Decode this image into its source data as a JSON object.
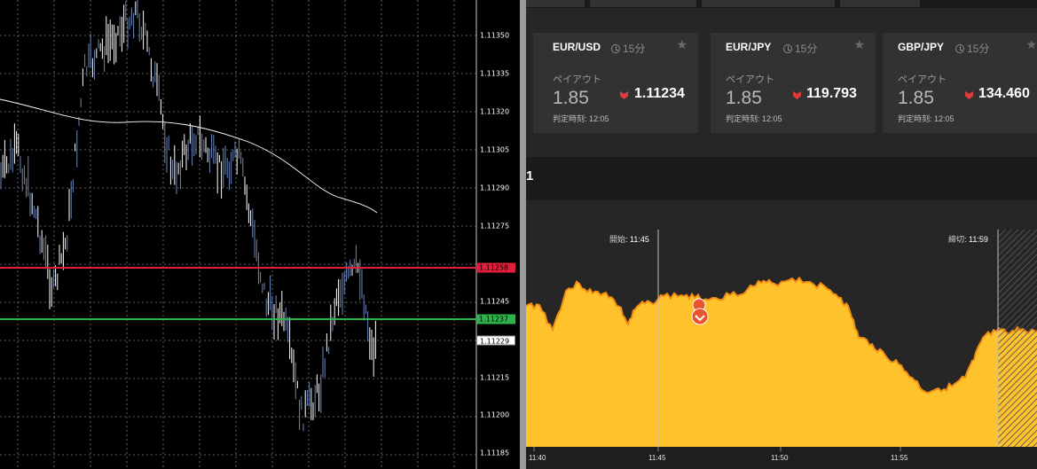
{
  "mt4": {
    "price_labels": [
      "1.11350",
      "1.11335",
      "1.11320",
      "1.11305",
      "1.11290",
      "1.11275",
      "1.11245",
      "1.11215",
      "1.11200",
      "1.11185"
    ],
    "red_line_label": "1.11258",
    "green_line_label": "1.11237",
    "current_price_label": "1.11229",
    "colors": {
      "background": "#000000",
      "candles": "#ffffff",
      "ma": "#ffffff",
      "red_line": "#e0203a",
      "green_line": "#2db34a",
      "grid": "#7a7a7a"
    }
  },
  "panel": {
    "cards": [
      {
        "pair": "EUR/USD",
        "expiry": "15分",
        "payout_label": "ペイアウト",
        "payout": "1.85",
        "price": "1.11234",
        "direction_icon": "down-arrow-icon",
        "judge_label": "判定時刻",
        "judge_time": "12:05"
      },
      {
        "pair": "EUR/JPY",
        "expiry": "15分",
        "payout_label": "ペイアウト",
        "payout": "1.85",
        "price": "119.793",
        "direction_icon": "down-arrow-icon",
        "judge_label": "判定時刻",
        "judge_time": "12:05"
      },
      {
        "pair": "GBP/JPY",
        "expiry": "15分",
        "payout_label": "ペイアウト",
        "payout": "1.85",
        "price": "134.460",
        "direction_icon": "down-arrow-icon",
        "judge_label": "判定時刻",
        "judge_time": "12:05"
      }
    ],
    "subheader_text": "1",
    "chart": {
      "start_label": "開始",
      "start_time": "11:45",
      "close_label": "締切",
      "close_time": "11:59",
      "x_ticks": [
        "11:40",
        "11:45",
        "11:50",
        "11:55"
      ],
      "colors": {
        "area": "#fec22d",
        "area_edge": "#f28c12",
        "background": "#262626",
        "marker": "#e8542c"
      }
    }
  }
}
